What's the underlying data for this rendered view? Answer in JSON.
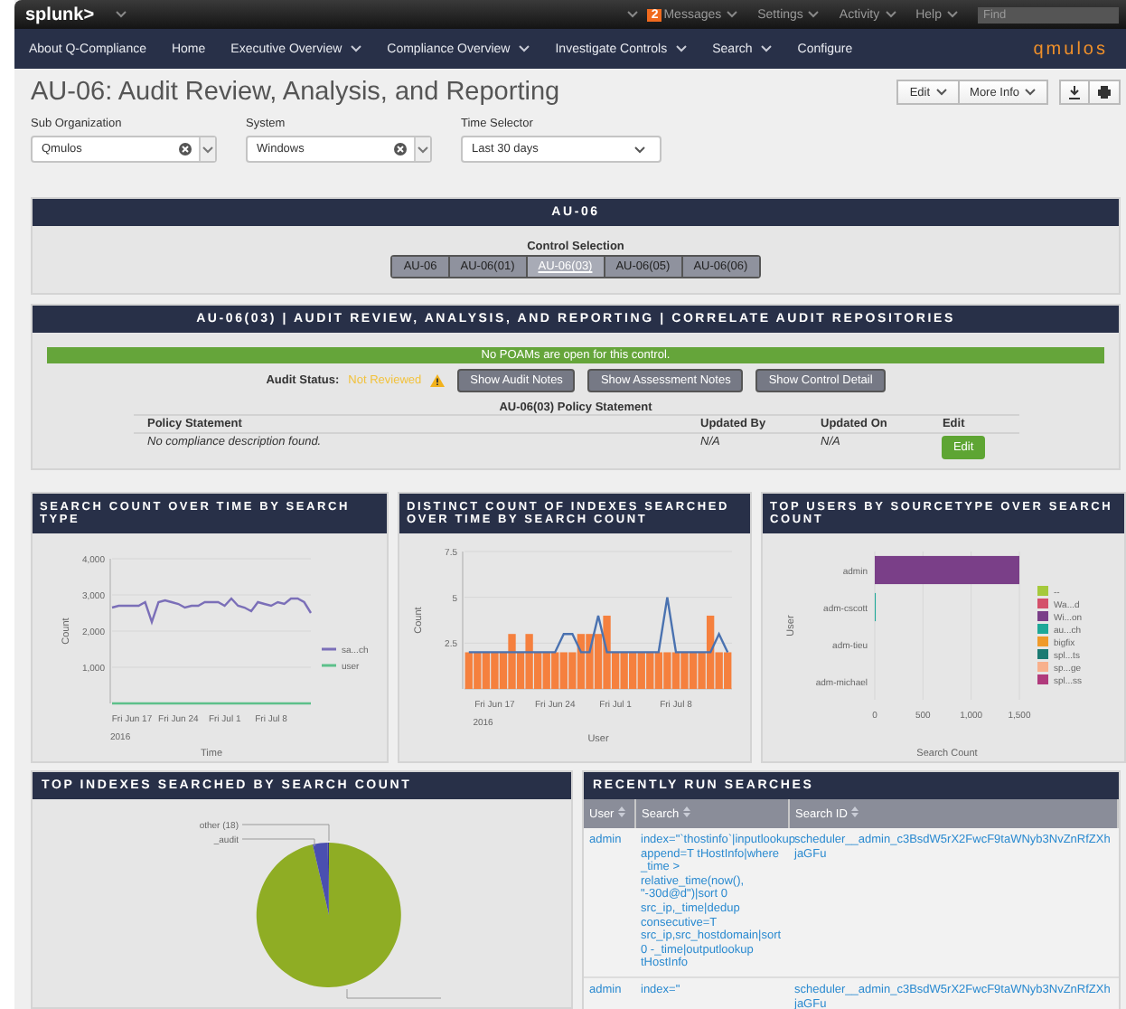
{
  "topbar": {
    "logo": "splunk>",
    "badge": "2",
    "menus": [
      "Messages",
      "Settings",
      "Activity",
      "Help"
    ],
    "search": {
      "placeholder": "Find"
    }
  },
  "nav": {
    "items": [
      {
        "label": "About Q-Compliance",
        "dropdown": false
      },
      {
        "label": "Home",
        "dropdown": false
      },
      {
        "label": "Executive Overview",
        "dropdown": true
      },
      {
        "label": "Compliance Overview",
        "dropdown": true
      },
      {
        "label": "Investigate Controls",
        "dropdown": true
      },
      {
        "label": "Search",
        "dropdown": true
      },
      {
        "label": "Configure",
        "dropdown": false
      }
    ],
    "brand": "qmulos"
  },
  "page": {
    "title": "AU-06: Audit Review, Analysis, and Reporting",
    "buttons": [
      {
        "kind": "dropdown",
        "label": "Edit"
      },
      {
        "kind": "dropdown",
        "label": "More Info"
      },
      {
        "kind": "download"
      },
      {
        "kind": "print"
      }
    ]
  },
  "filters": [
    {
      "kind": "multiselect",
      "label": "Sub Organization",
      "value": "Qmulos"
    },
    {
      "kind": "multiselect",
      "label": "System",
      "value": "Windows"
    },
    {
      "kind": "dropdown",
      "label": "Time Selector",
      "value": "Last 30 days"
    }
  ],
  "control_panel": {
    "title": "AU-06",
    "selection_label": "Control Selection",
    "controls": [
      {
        "label": "AU-06",
        "selected": false
      },
      {
        "label": "AU-06(01)",
        "selected": false
      },
      {
        "label": "AU-06(03)",
        "selected": true
      },
      {
        "label": "AU-06(05)",
        "selected": false
      },
      {
        "label": "AU-06(06)",
        "selected": false
      }
    ]
  },
  "detail_panel": {
    "title": "AU-06(03) | AUDIT REVIEW, ANALYSIS, AND REPORTING | CORRELATE AUDIT REPOSITORIES",
    "banner": "No POAMs are open for this control.",
    "audit_status_label": "Audit Status:",
    "audit_status": "Not Reviewed",
    "buttons": [
      "Show Audit Notes",
      "Show Assessment Notes",
      "Show Control Detail"
    ],
    "policy_title": "AU-06(03) Policy Statement",
    "policy_table": {
      "columns": [
        "Policy Statement",
        "Updated By",
        "Updated On",
        "Edit"
      ],
      "rows": [
        {
          "statement": "No compliance description found.",
          "updated_by": "N/A",
          "updated_on": "N/A",
          "action": "Edit"
        }
      ]
    }
  },
  "charts": [
    {
      "title": "SEARCH COUNT OVER TIME BY SEARCH TYPE",
      "chart_data": {
        "type": "line",
        "xlabel": "Time",
        "ylabel": "Count",
        "grid": true,
        "legend": true,
        "categories": [
          null,
          null,
          null,
          "Fri Jun 17",
          null,
          null,
          null,
          null,
          null,
          null,
          "Fri Jun 24",
          null,
          null,
          null,
          null,
          null,
          null,
          "Fri Jul 1",
          null,
          null,
          null,
          null,
          null,
          null,
          "Fri Jul 8",
          null,
          null,
          null,
          null,
          null,
          null
        ],
        "series": [
          {
            "name": "sa...ch",
            "color": "#7b6fb8",
            "values": [
              2650,
              2700,
              2700,
              2700,
              2700,
              2800,
              2250,
              2800,
              2850,
              2800,
              2750,
              2650,
              2700,
              2700,
              2800,
              2800,
              2800,
              2700,
              2900,
              2700,
              2650,
              2550,
              2800,
              2750,
              2700,
              2800,
              2750,
              2900,
              2900,
              2800,
              2500
            ]
          },
          {
            "name": "user",
            "color": "#5cc08a",
            "values": [
              0,
              0,
              0,
              0,
              0,
              0,
              0,
              0,
              0,
              0,
              0,
              0,
              0,
              0,
              0,
              0,
              0,
              0,
              0,
              0,
              0,
              0,
              0,
              0,
              0,
              0,
              0,
              0,
              0,
              0,
              0
            ]
          }
        ],
        "ylim": [
          0,
          4000
        ],
        "yticks": [
          {
            "value": 1000,
            "label": "1,000"
          },
          {
            "value": 2000,
            "label": "2,000"
          },
          {
            "value": 3000,
            "label": "3,000"
          },
          {
            "value": 4000,
            "label": "4,000"
          }
        ],
        "annotations": [
          "2016"
        ]
      }
    },
    {
      "title": "DISTINCT COUNT OF INDEXES SEARCHED OVER TIME BY SEARCH COUNT",
      "chart_data": {
        "type": "bar",
        "xlabel": "User",
        "ylabel": "Count",
        "grid": true,
        "categories": [
          null,
          null,
          null,
          "Fri Jun 17",
          null,
          null,
          null,
          null,
          null,
          null,
          "Fri Jun 24",
          null,
          null,
          null,
          null,
          null,
          null,
          "Fri Jul 1",
          null,
          null,
          null,
          null,
          null,
          null,
          "Fri Jul 8",
          null,
          null,
          null,
          null,
          null,
          null
        ],
        "series": [
          {
            "color": "#f5803e",
            "values": [
              2,
              2,
              2,
              2,
              2,
              3,
              2,
              3,
              2,
              2,
              2,
              2,
              2,
              3,
              3,
              3,
              4,
              2,
              2,
              2,
              2,
              2,
              2,
              2,
              2,
              2,
              2,
              2,
              4,
              2,
              2
            ]
          },
          {
            "type": "line",
            "color": "#4a72b0",
            "values": [
              2,
              2,
              2,
              2,
              2,
              2,
              2,
              2,
              2,
              2,
              2,
              3,
              3,
              2,
              2,
              4,
              2,
              2,
              2,
              2,
              2,
              2,
              2,
              5,
              2,
              2,
              2,
              2,
              2,
              3,
              2
            ]
          }
        ],
        "ylim": [
          0,
          7.5
        ],
        "yticks": [
          2.5,
          5,
          7.5
        ],
        "annotations": [
          "2016"
        ]
      }
    },
    {
      "title": "TOP USERS BY SOURCETYPE OVER SEARCH COUNT",
      "chart_data": {
        "type": "bar",
        "orientation": "horizontal",
        "stacked": true,
        "grid": true,
        "legend": true,
        "xlim": [
          0,
          1500
        ],
        "xlabel": "Search Count",
        "ylabel": "User",
        "categories": [
          "admin",
          "adm-cscott",
          "adm-tieu",
          "adm-michael"
        ],
        "series": [
          {
            "name": "--",
            "color": "#a5c93c",
            "values": [
              0,
              0,
              0,
              0
            ]
          },
          {
            "name": "Wa...d",
            "color": "#d4506a",
            "values": [
              0,
              0,
              0,
              0
            ]
          },
          {
            "name": "Wi...on",
            "color": "#7a3f88",
            "values": [
              1500,
              0,
              0,
              0
            ]
          },
          {
            "name": "au...ch",
            "color": "#1ea898",
            "values": [
              0,
              10,
              0,
              0
            ]
          },
          {
            "name": "bigfix",
            "color": "#f09a2a",
            "values": [
              0,
              0,
              0,
              0
            ]
          },
          {
            "name": "spl...ts",
            "color": "#1b7a72",
            "values": [
              0,
              0,
              0,
              0
            ]
          },
          {
            "name": "sp...ge",
            "color": "#f8b08c",
            "values": [
              0,
              0,
              0,
              0
            ]
          },
          {
            "name": "spl...ss",
            "color": "#b03a7c",
            "values": [
              0,
              0,
              0,
              0
            ]
          }
        ],
        "xticks": [
          {
            "value": 0,
            "label": "0"
          },
          {
            "value": 500,
            "label": "500"
          },
          {
            "value": 1000,
            "label": "1,000"
          },
          {
            "value": 1500,
            "label": "1,500"
          }
        ]
      }
    }
  ],
  "pie_panel": {
    "title": "TOP INDEXES SEARCHED BY SEARCH COUNT",
    "labels": [
      "other (18)",
      "_audit"
    ]
  },
  "searches_panel": {
    "title": "RECENTLY RUN SEARCHES",
    "columns": [
      "User",
      "Search",
      "Search ID"
    ],
    "rows": [
      {
        "user": "admin",
        "search": "index=\"`thostinfo`|inputlookup append=T tHostInfo|where _time > relative_time(now(), \"-30d@d\")|sort 0 src_ip,_time|dedup consecutive=T src_ip,src_hostdomain|sort 0 -_time|outputlookup tHostInfo",
        "search_id": "scheduler__admin_c3BsdW5rX2FwcF9taWNyb3NvZnRfZXhjaGFu"
      },
      {
        "user": "admin",
        "search": "index=\"",
        "search_id": "scheduler__admin_c3BsdW5rX2FwcF9taWNyb3NvZnRfZXhjaGFu"
      }
    ]
  }
}
